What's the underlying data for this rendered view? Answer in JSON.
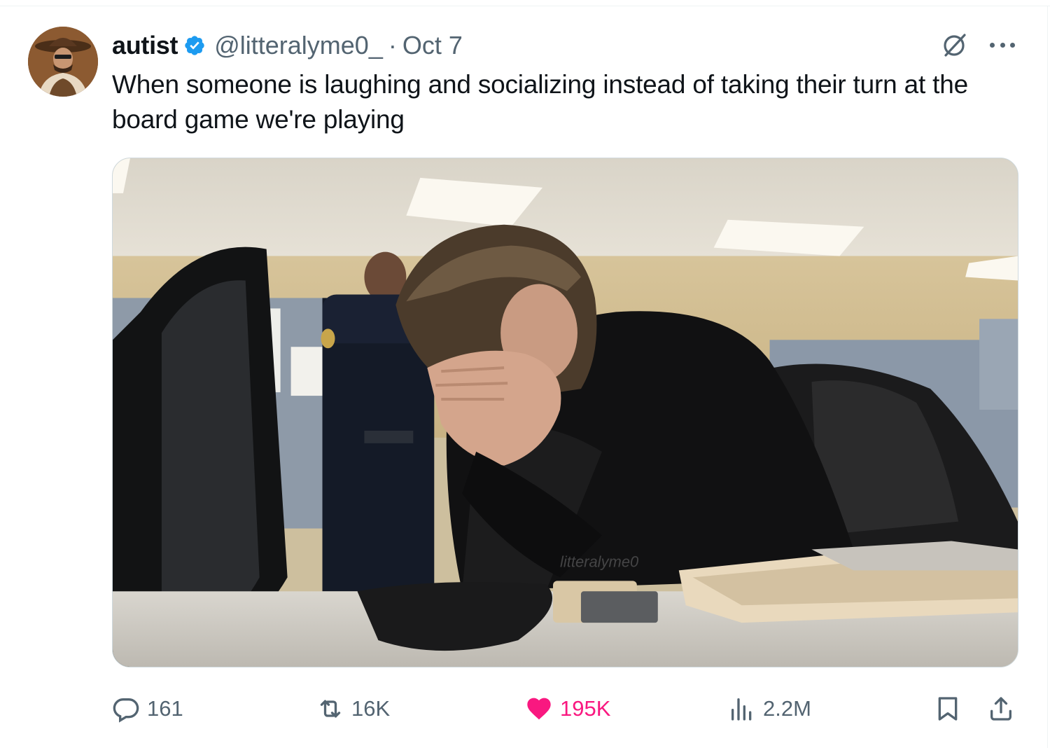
{
  "tweet": {
    "display_name": "autist",
    "handle": "@litteralyme0_",
    "separator": "·",
    "date": "Oct 7",
    "text": "When someone is laughing and socializing instead of taking their turn at the board game we're playing",
    "media_watermark": "litteralyme0"
  },
  "metrics": {
    "replies": "161",
    "reposts": "16K",
    "likes": "195K",
    "views": "2.2M"
  },
  "icons": {
    "verified": "verified-badge-icon",
    "grok": "grok-icon",
    "more": "more-icon",
    "reply": "reply-icon",
    "repost": "repost-icon",
    "like": "heart-icon",
    "views": "views-icon",
    "bookmark": "bookmark-icon",
    "share": "share-icon"
  },
  "colors": {
    "verified_blue": "#1d9bf0",
    "like_pink": "#f91880",
    "secondary_text": "#536471",
    "primary_text": "#0f1419"
  },
  "state": {
    "liked": true
  }
}
